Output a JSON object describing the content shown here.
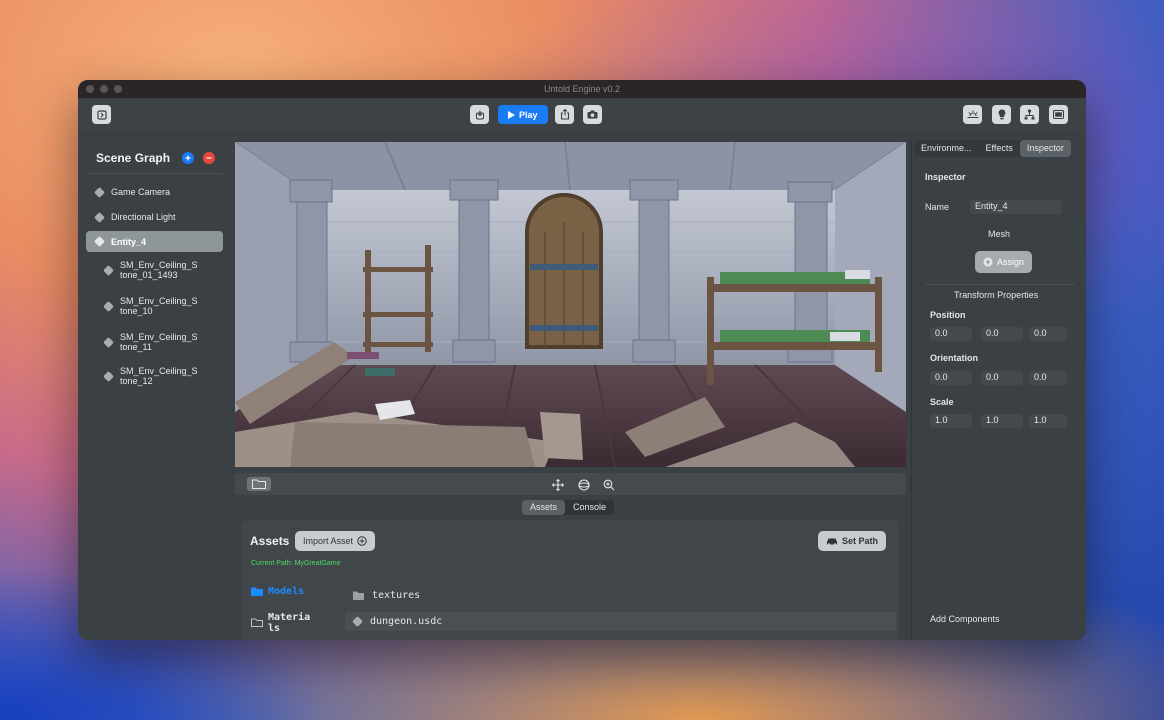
{
  "window": {
    "title": "Untold Engine v0.2"
  },
  "toolbar": {
    "left_icon": "panel-toggle-icon",
    "import_icon": "import-icon",
    "play_label": "Play",
    "play_icon": "play-icon",
    "share_icon": "share-icon",
    "camera_icon": "camera-icon",
    "right_icons": [
      "sunrise-icon",
      "lightbulb-icon",
      "hierarchy-icon",
      "window-icon"
    ]
  },
  "scene_graph": {
    "title": "Scene Graph",
    "add_color": "#1a7cf5",
    "remove_color": "#e5483d",
    "items": [
      {
        "label": "Game Camera"
      },
      {
        "label": "Directional Light"
      },
      {
        "label": "Entity_4",
        "selected": true
      },
      {
        "label1": "SM_Env_Ceiling_S",
        "label2": "tone_01_1493"
      },
      {
        "label1": "SM_Env_Ceiling_S",
        "label2": "tone_10"
      },
      {
        "label1": "SM_Env_Ceiling_S",
        "label2": "tone_11"
      },
      {
        "label1": "SM_Env_Ceiling_S",
        "label2": "tone_12"
      }
    ]
  },
  "viewport_bar": {
    "folder_icon": "folder-icon",
    "tools": [
      "move-icon",
      "orbit-icon",
      "zoom-icon"
    ]
  },
  "bottom": {
    "tabs": [
      "Assets",
      "Console"
    ],
    "active_tab": "Assets",
    "assets_title": "Assets",
    "import_label": "Import Asset",
    "set_path_label": "Set Path",
    "current_path": "Current Path: MyGreatGame",
    "categories": [
      {
        "label": "Models",
        "active": true
      },
      {
        "label": "Materia",
        "label2": "ls"
      }
    ],
    "files": [
      {
        "name": "textures",
        "icon": "folder-icon"
      },
      {
        "name": "dungeon.usdc",
        "icon": "cube-icon"
      }
    ]
  },
  "inspector": {
    "tabs": [
      "Environme...",
      "Effects",
      "Inspector"
    ],
    "active_tab": "Inspector",
    "heading": "Inspector",
    "name_label": "Name",
    "name_value": "Entity_4",
    "mesh_label": "Mesh",
    "assign_label": "Assign",
    "transform_label": "Transform Properties",
    "position_label": "Position",
    "position": [
      "0.0",
      "0.0",
      "0.0"
    ],
    "orientation_label": "Orientation",
    "orientation": [
      "0.0",
      "0.0",
      "0.0"
    ],
    "scale_label": "Scale",
    "scale": [
      "1.0",
      "1.0",
      "1.0"
    ],
    "add_components": "Add Components"
  }
}
